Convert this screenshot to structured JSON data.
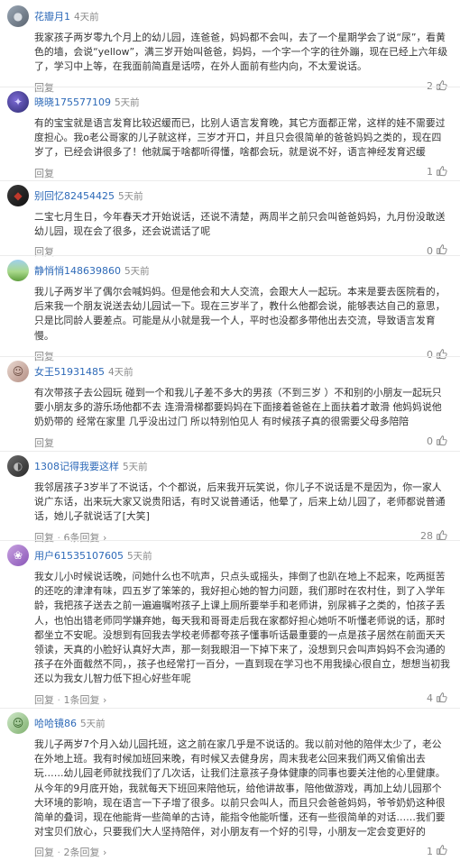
{
  "comments": [
    {
      "user": "花瓣月1",
      "time": "4天前",
      "text": "我家孩子两岁零九个月上的幼儿园，连爸爸，妈妈都不会叫，去了一个星期学会了说“尿”，看黄色的墙，会说“yellow”，满三岁开始叫爸爸，妈妈，一个字一个字的往外蹦，现在已经上六年级了，学习中上等，在我面前简直是话唠，在外人面前有些内向，不太爱说话。",
      "reply": "回复",
      "reply_count": "",
      "likes": "2"
    },
    {
      "user": "晓晓175577109",
      "time": "5天前",
      "text": "有的宝宝就是语言发育比较迟缓而已，比别人语言发育晚，其它方面都正常，这样的娃不需要过度担心。我o老公哥家的儿子就这样，三岁才开口，并且只会很简单的爸爸妈妈之类的，现在四岁了，已经会讲很多了！他就属于啥都听得懂，啥都会玩，就是说不好，语言神经发育迟缓",
      "reply": "回复",
      "reply_count": "",
      "likes": "1"
    },
    {
      "user": "别回忆82454425",
      "time": "5天前",
      "text": "二宝七月生日，今年春天才开始说话，还说不清楚，两周半之前只会叫爸爸妈妈，九月份没敢送幼儿园，现在会了很多，还会说谎话了呢",
      "reply": "回复",
      "reply_count": "",
      "likes": "0"
    },
    {
      "user": "静悄悄148639860",
      "time": "5天前",
      "text": "我儿子两岁半了偶尔会喊妈妈。但是他会和大人交流，会跟大人一起玩。本来是要去医院看的，后来我一个朋友说送去幼儿园试一下。现在三岁半了，教什么他都会说，能够表达自己的意思，只是比同龄人要差点。可能是从小就是我一个人，平时也没都多带他出去交流，导致语言发育慢。",
      "reply": "回复",
      "reply_count": "",
      "likes": "0"
    },
    {
      "user": "女王51931485",
      "time": "4天前",
      "text": "有次带孩子去公园玩 碰到一个和我儿子差不多大的男孩（不到三岁 ）不和别的小朋友一起玩只要小朋友多的游乐场他都不去 连滑滑梯都要妈妈在下面接着爸爸在上面扶着才敢滑 他妈妈说他奶奶带的 经常在家里 几乎没出过门 所以特别怕见人 有时候孩子真的很需要父母多陪陪",
      "reply": "回复",
      "reply_count": "",
      "likes": "0"
    },
    {
      "user": "1308记得我要这样",
      "time": "5天前",
      "text": "我邻居孩子3岁半了不说话，个个都说，后来我开玩笑说，你儿子不说话是不是因为，你一家人说广东话，出来玩大家又说贵阳话，有时又说普通话，他晕了，后来上幼儿园了，老师都说普通话，她儿子就说话了[大笑]",
      "reply": "回复",
      "reply_count": "6条回复",
      "likes": "28"
    },
    {
      "user": "用户61535107605",
      "time": "5天前",
      "text": "我女儿小时候说话晚，问她什么也不吭声，只点头或摇头，摔倒了也趴在地上不起来，吃两挺苦的还吃的津津有味，四五岁了笨笨的，我好担心她的智力问题，我们那时在农村住，到了入学年龄，我把孩子送去之前一遍遍嘱咐孩子上课上厕所要举手和老师讲，别尿裤子之类的，怕孩子丢人，也怕出错老师同学嫌弃她，每天我和哥哥走后我在家都好担心她听不听懂老师说的话，那时都坐立不安呢。没想到有回我去学校老师都夸孩子懂事听话最重要的一点是孩子居然在前面天天领读，天真的小脸好认真好大声，那一刻我眼泪一下掉下来了，没想到只会叫声妈妈不会沟通的孩子在外面截然不同，，孩子也经常打一百分，一直到现在学习也不用我操心很自立，想想当初我还以为我女儿智力低下担心好些年呢",
      "reply": "回复",
      "reply_count": "1条回复",
      "likes": "4"
    },
    {
      "user": "哈哈镜86",
      "time": "5天前",
      "text": "我儿子两岁7个月入幼儿园托班，这之前在家几乎是不说话的。我以前对他的陪伴太少了，老公在外地上班。我有时候加班回来晚，有时候又去健身房，周末我老公回来我们两又偷偷出去玩……幼儿园老师就找我们了几次话，让我们注意孩子身体健康的同事也要关注他的心里健康。从今年的9月底开始，我就每天下班回来陪他玩，给他讲故事，陪他做游戏，再加上幼儿园那个大环境的影响，现在语言一下子增了很多。以前只会叫人，而且只会爸爸妈妈，爷爷奶奶这种很简单的叠词，现在他能背一些简单的古诗，能指令他能听懂，还有一些很简单的对话……我们要对宝贝们放心，只要我们大人坚持陪伴，对小朋友有一个好的引导，小朋友一定会变更好的",
      "reply": "回复",
      "reply_count": "2条回复",
      "likes": "1"
    }
  ]
}
